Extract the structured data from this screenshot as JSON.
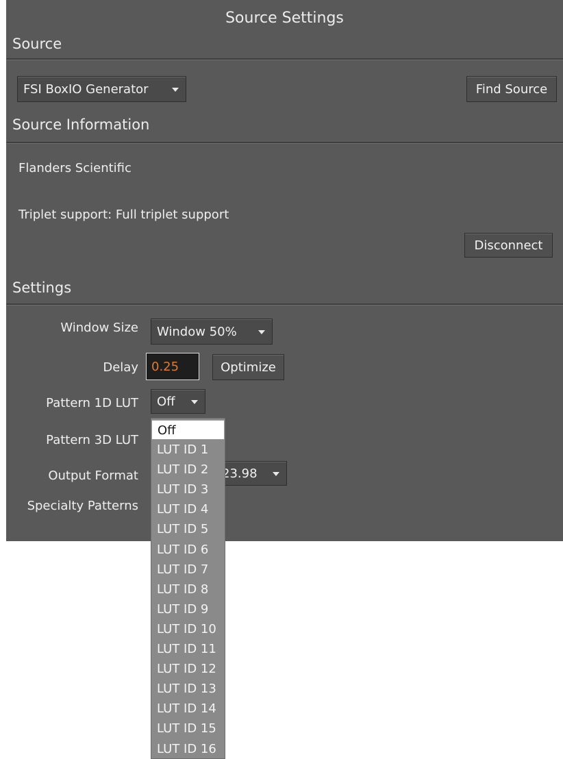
{
  "window": {
    "title": "Source Settings"
  },
  "source": {
    "heading": "Source",
    "selected": "FSI BoxIO Generator",
    "find_label": "Find Source"
  },
  "info": {
    "heading": "Source Information",
    "manufacturer": "Flanders Scientific",
    "triplet": "Triplet support: Full triplet support",
    "disconnect_label": "Disconnect"
  },
  "settings": {
    "heading": "Settings",
    "window_size": {
      "label": "Window Size",
      "value": "Window 50%"
    },
    "delay": {
      "label": "Delay",
      "value": "0.25",
      "optimize_label": "Optimize"
    },
    "lut1d": {
      "label": "Pattern 1D LUT",
      "value": "Off"
    },
    "lut3d": {
      "label": "Pattern 3D LUT"
    },
    "output_format": {
      "label": "Output Format",
      "value_visible": "23.98"
    },
    "specialty": {
      "label": "Specialty Patterns"
    }
  },
  "lut_menu": {
    "items": [
      "Off",
      "LUT ID 1",
      "LUT ID 2",
      "LUT ID 3",
      "LUT ID 4",
      "LUT ID 5",
      "LUT ID 6",
      "LUT ID 7",
      "LUT ID 8",
      "LUT ID 9",
      "LUT ID 10",
      "LUT ID 11",
      "LUT ID 12",
      "LUT ID 13",
      "LUT ID 14",
      "LUT ID 15",
      "LUT ID 16"
    ],
    "selected_index": 0
  },
  "colors": {
    "panel_bg": "#595959",
    "delay_text": "#e07a2e",
    "menu_bg": "#8a8a8a"
  },
  "icons": {
    "dropdown_caret": "chevron-down-icon"
  }
}
